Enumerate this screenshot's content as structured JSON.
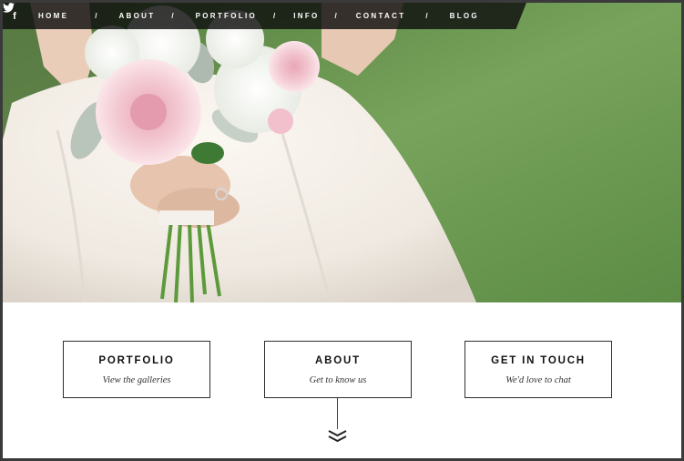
{
  "nav": {
    "social": [
      {
        "name": "facebook",
        "icon": "facebook-icon",
        "glyph": "f"
      },
      {
        "name": "twitter",
        "icon": "twitter-bird-icon"
      }
    ],
    "items": [
      {
        "label": "HOME"
      },
      {
        "label": "ABOUT"
      },
      {
        "label": "PORTFOLIO"
      },
      {
        "label": "INFO"
      },
      {
        "label": "CONTACT"
      },
      {
        "label": "BLOG"
      }
    ],
    "separator": "/"
  },
  "hero": {
    "image": "bride-holding-bouquet-photo"
  },
  "cards": [
    {
      "title": "PORTFOLIO",
      "subtitle": "View the galleries"
    },
    {
      "title": "ABOUT",
      "subtitle": "Get to know us"
    },
    {
      "title": "GET IN TOUCH",
      "subtitle": "We'd love to chat"
    }
  ],
  "scroll_icon": "double-chevron-down-icon",
  "colors": {
    "nav_bg": "#0f0f0f",
    "frame": "#3a3a3a",
    "grass": "#6f9a52",
    "card_border": "#2e2e2e"
  }
}
